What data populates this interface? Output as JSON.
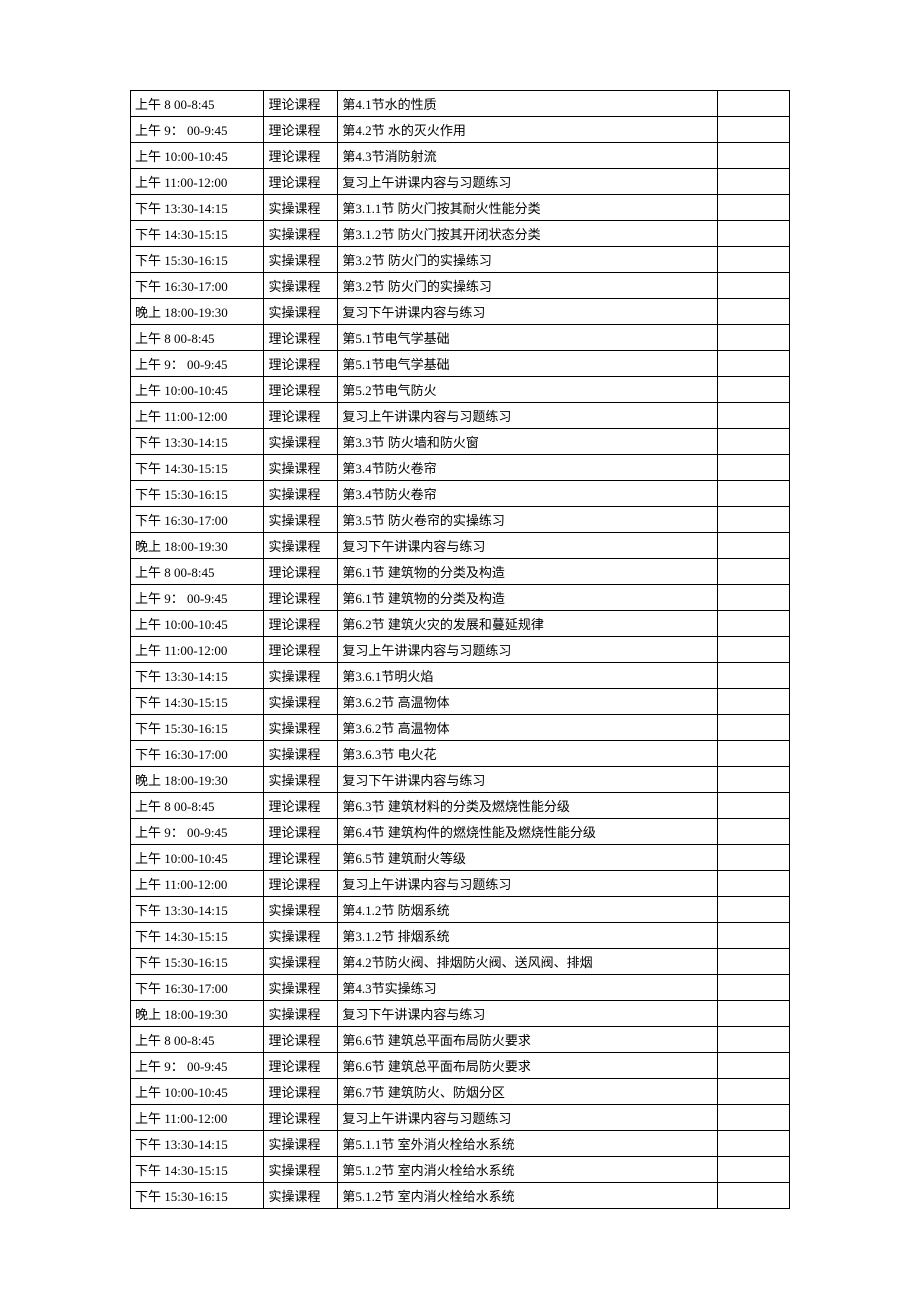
{
  "rows": [
    {
      "time": "上午 8 00-8:45",
      "type": "理论课程",
      "content": "第4.1节水的性质"
    },
    {
      "time": "上午 9： 00-9:45",
      "type": "理论课程",
      "content": "第4.2节   水的灭火作用"
    },
    {
      "time": "上午 10:00-10:45",
      "type": "理论课程",
      "content": "第4.3节消防射流"
    },
    {
      "time": "上午 11:00-12:00",
      "type": "理论课程",
      "content": "复习上午讲课内容与习题练习"
    },
    {
      "time": "下午 13:30-14:15",
      "type": "实操课程",
      "content": "第3.1.1节 防火门按其耐火性能分类"
    },
    {
      "time": "下午 14:30-15:15",
      "type": "实操课程",
      "content": "第3.1.2节 防火门按其开闭状态分类"
    },
    {
      "time": "下午 15:30-16:15",
      "type": "实操课程",
      "content": "第3.2节   防火门的实操练习"
    },
    {
      "time": "下午 16:30-17:00",
      "type": "实操课程",
      "content": "第3.2节   防火门的实操练习"
    },
    {
      "time": "晚上 18:00-19:30",
      "type": "实操课程",
      "content": "复习下午讲课内容与练习"
    },
    {
      "time": "上午 8 00-8:45",
      "type": "理论课程",
      "content": "第5.1节电气学基础"
    },
    {
      "time": "上午 9： 00-9:45",
      "type": "理论课程",
      "content": "第5.1节电气学基础"
    },
    {
      "time": "上午 10:00-10:45",
      "type": "理论课程",
      "content": "第5.2节电气防火"
    },
    {
      "time": "上午 11:00-12:00",
      "type": "理论课程",
      "content": "复习上午讲课内容与习题练习"
    },
    {
      "time": "下午 13:30-14:15",
      "type": "实操课程",
      "content": "第3.3节   防火墙和防火窗"
    },
    {
      "time": "下午 14:30-15:15",
      "type": "实操课程",
      "content": "第3.4节防火卷帘"
    },
    {
      "time": "下午 15:30-16:15",
      "type": "实操课程",
      "content": "第3.4节防火卷帘"
    },
    {
      "time": "下午 16:30-17:00",
      "type": "实操课程",
      "content": "第3.5节 防火卷帘的实操练习"
    },
    {
      "time": "晚上 18:00-19:30",
      "type": "实操课程",
      "content": "复习下午讲课内容与练习"
    },
    {
      "time": "上午 8 00-8:45",
      "type": "理论课程",
      "content": "第6.1节 建筑物的分类及构造"
    },
    {
      "time": "上午 9： 00-9:45",
      "type": "理论课程",
      "content": "第6.1节 建筑物的分类及构造"
    },
    {
      "time": "上午 10:00-10:45",
      "type": "理论课程",
      "content": "第6.2节 建筑火灾的发展和蔓延规律"
    },
    {
      "time": "上午 11:00-12:00",
      "type": "理论课程",
      "content": "复习上午讲课内容与习题练习"
    },
    {
      "time": "下午 13:30-14:15",
      "type": "实操课程",
      "content": "第3.6.1节明火焰"
    },
    {
      "time": "下午 14:30-15:15",
      "type": "实操课程",
      "content": "第3.6.2节 高温物体"
    },
    {
      "time": "下午 15:30-16:15",
      "type": "实操课程",
      "content": "第3.6.2节 高温物体"
    },
    {
      "time": "下午 16:30-17:00",
      "type": "实操课程",
      "content": "第3.6.3节 电火花"
    },
    {
      "time": "晚上 18:00-19:30",
      "type": "实操课程",
      "content": "复习下午讲课内容与练习"
    },
    {
      "time": "上午 8 00-8:45",
      "type": "理论课程",
      "content": "第6.3节 建筑材料的分类及燃烧性能分级"
    },
    {
      "time": "上午 9： 00-9:45",
      "type": "理论课程",
      "content": "第6.4节   建筑构件的燃烧性能及燃烧性能分级"
    },
    {
      "time": "上午 10:00-10:45",
      "type": "理论课程",
      "content": "第6.5节 建筑耐火等级"
    },
    {
      "time": "上午 11:00-12:00",
      "type": "理论课程",
      "content": "复习上午讲课内容与习题练习"
    },
    {
      "time": "下午 13:30-14:15",
      "type": "实操课程",
      "content": "第4.1.2节 防烟系统"
    },
    {
      "time": "下午 14:30-15:15",
      "type": "实操课程",
      "content": "第3.1.2节 排烟系统"
    },
    {
      "time": "下午 15:30-16:15",
      "type": "实操课程",
      "content": "第4.2节防火阀、排烟防火阀、送风阀、排烟"
    },
    {
      "time": "下午 16:30-17:00",
      "type": "实操课程",
      "content": "第4.3节实操练习"
    },
    {
      "time": "晚上 18:00-19:30",
      "type": "实操课程",
      "content": "复习下午讲课内容与练习"
    },
    {
      "time": "上午 8 00-8:45",
      "type": "理论课程",
      "content": "第6.6节   建筑总平面布局防火要求"
    },
    {
      "time": "上午 9： 00-9:45",
      "type": "理论课程",
      "content": "第6.6节   建筑总平面布局防火要求"
    },
    {
      "time": "上午 10:00-10:45",
      "type": "理论课程",
      "content": "第6.7节 建筑防火、防烟分区"
    },
    {
      "time": "上午 11:00-12:00",
      "type": "理论课程",
      "content": "复习上午讲课内容与习题练习"
    },
    {
      "time": "下午 13:30-14:15",
      "type": "实操课程",
      "content": "第5.1.1节 室外消火栓给水系统"
    },
    {
      "time": "下午 14:30-15:15",
      "type": "实操课程",
      "content": "第5.1.2节 室内消火栓给水系统"
    },
    {
      "time": "下午 15:30-16:15",
      "type": "实操课程",
      "content": "第5.1.2节 室内消火栓给水系统"
    }
  ]
}
